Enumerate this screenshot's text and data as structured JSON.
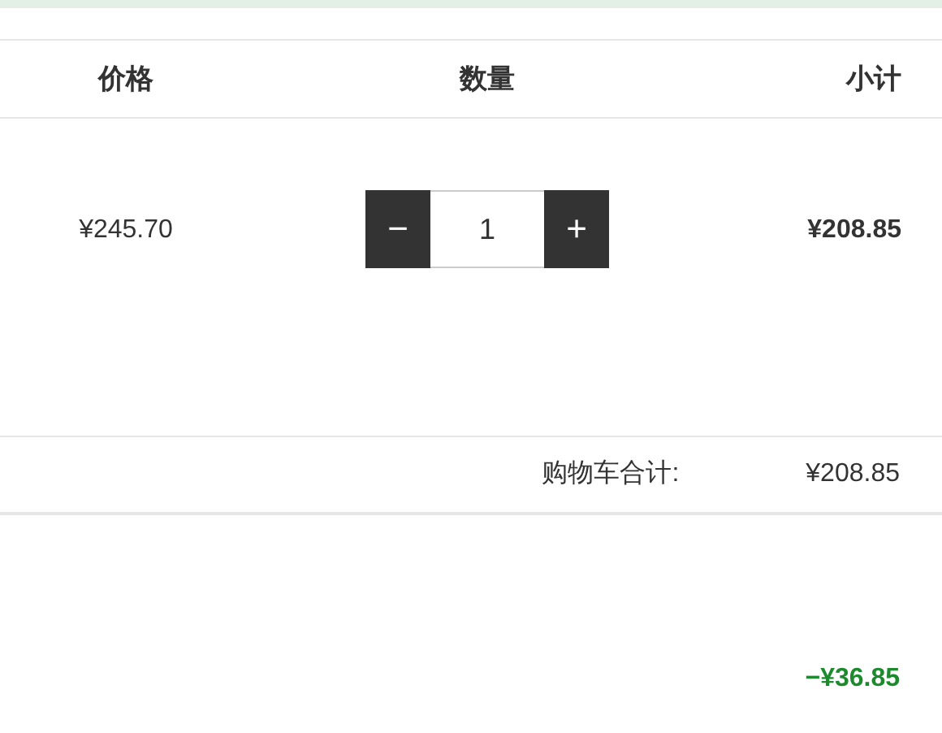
{
  "table": {
    "columns": [
      {
        "label": "价格"
      },
      {
        "label": "数量"
      },
      {
        "label": "小计"
      }
    ],
    "rows": [
      {
        "price": "¥245.70",
        "quantity": {
          "minus": "−",
          "value": "1",
          "plus": "+"
        },
        "subtotal": "¥208.85"
      }
    ]
  },
  "cart_total": {
    "label": "购物车合计:",
    "value": "¥208.85"
  },
  "discount": {
    "value": "−¥36.85"
  }
}
